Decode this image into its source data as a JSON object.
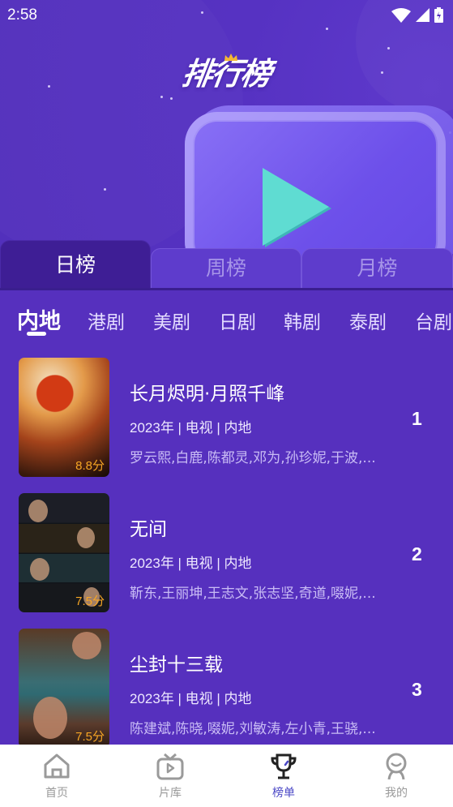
{
  "status_bar": {
    "time": "2:58",
    "icons": [
      "wifi-icon",
      "signal-icon",
      "battery-charging-icon"
    ]
  },
  "hero": {
    "title": "排行榜"
  },
  "period_tabs": [
    {
      "label": "日榜",
      "active": true
    },
    {
      "label": "周榜",
      "active": false
    },
    {
      "label": "月榜",
      "active": false
    }
  ],
  "categories": [
    {
      "label": "内地",
      "active": true
    },
    {
      "label": "港剧",
      "active": false
    },
    {
      "label": "美剧",
      "active": false
    },
    {
      "label": "日剧",
      "active": false
    },
    {
      "label": "韩剧",
      "active": false
    },
    {
      "label": "泰剧",
      "active": false
    },
    {
      "label": "台剧",
      "active": false
    }
  ],
  "rankings": [
    {
      "rank": "1",
      "title": "长月烬明·月照千峰",
      "meta": "2023年 | 电视 | 内地",
      "cast": "罗云熙,白鹿,陈都灵,邓为,孙珍妮,于波,...",
      "score": "8.8分"
    },
    {
      "rank": "2",
      "title": "无间",
      "meta": "2023年 | 电视 | 内地",
      "cast": "靳东,王丽坤,王志文,张志坚,奇道,啜妮,...",
      "score": "7.5分"
    },
    {
      "rank": "3",
      "title": "尘封十三载",
      "meta": "2023年 | 电视 | 内地",
      "cast": "陈建斌,陈晓,啜妮,刘敏涛,左小青,王骁,...",
      "score": "7.5分"
    }
  ],
  "bottom_nav": [
    {
      "label": "首页",
      "icon": "home-icon",
      "active": false
    },
    {
      "label": "片库",
      "icon": "tv-icon",
      "active": false
    },
    {
      "label": "榜单",
      "icon": "trophy-icon",
      "active": true
    },
    {
      "label": "我的",
      "icon": "user-icon",
      "active": false
    }
  ],
  "colors": {
    "background": "#5630be",
    "active_tab": "#3e1e95",
    "score": "#f7a624",
    "nav_active": "#4a47c6"
  }
}
